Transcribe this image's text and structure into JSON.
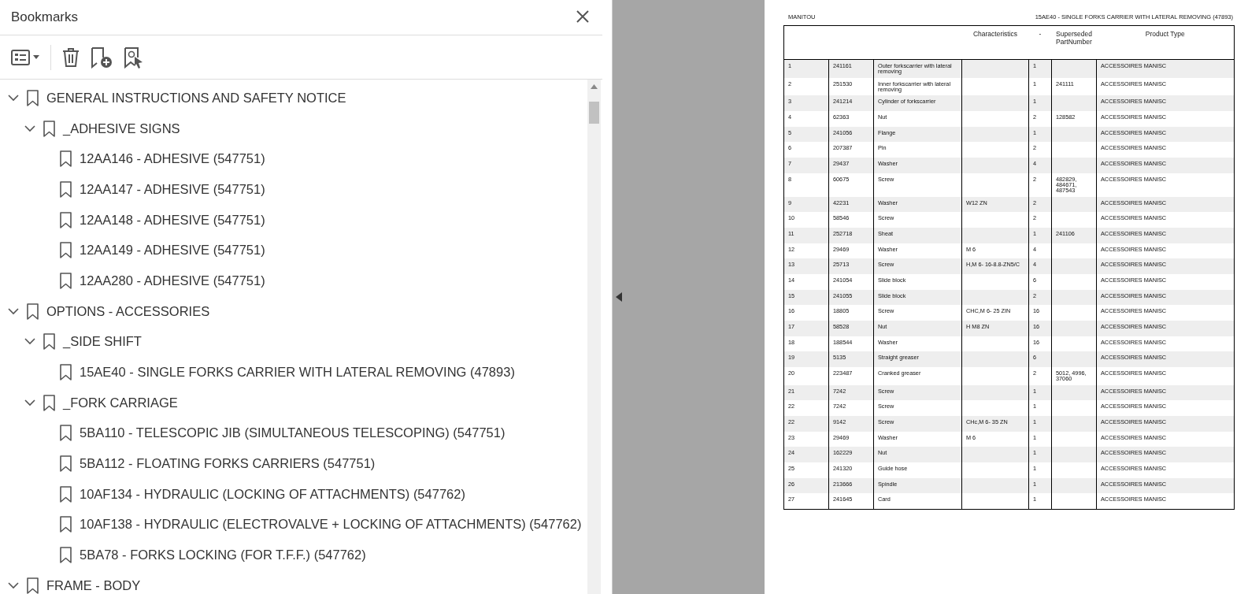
{
  "panel": {
    "title": "Bookmarks"
  },
  "bookmarks": [
    {
      "label": "GENERAL INSTRUCTIONS AND SAFETY NOTICE",
      "expanded": true,
      "children": [
        {
          "label": "_ADHESIVE SIGNS",
          "expanded": true,
          "children": [
            {
              "label": "12AA146 - ADHESIVE (547751)"
            },
            {
              "label": "12AA147 - ADHESIVE (547751)"
            },
            {
              "label": "12AA148 - ADHESIVE (547751)"
            },
            {
              "label": "12AA149 - ADHESIVE (547751)"
            },
            {
              "label": "12AA280 - ADHESIVE (547751)"
            }
          ]
        }
      ]
    },
    {
      "label": "OPTIONS - ACCESSORIES",
      "expanded": true,
      "children": [
        {
          "label": "_SIDE SHIFT",
          "expanded": true,
          "children": [
            {
              "label": "15AE40 - SINGLE FORKS CARRIER WITH LATERAL REMOVING (47893)"
            }
          ]
        },
        {
          "label": "_FORK CARRIAGE",
          "expanded": true,
          "children": [
            {
              "label": "5BA110 - TELESCOPIC JIB (SIMULTANEOUS TELESCOPING) (547751)"
            },
            {
              "label": "5BA112 - FLOATING FORKS CARRIERS (547751)"
            },
            {
              "label": "10AF134 - HYDRAULIC (LOCKING OF ATTACHMENTS) (547762)"
            },
            {
              "label": "10AF138 - HYDRAULIC (ELECTROVALVE + LOCKING OF ATTACHMENTS) (547762)"
            },
            {
              "label": "5BA78 - FORKS LOCKING (FOR T.F.F.) (547762)"
            }
          ]
        }
      ]
    },
    {
      "label": "FRAME - BODY",
      "expanded": true
    }
  ],
  "document": {
    "header_left": "MANITOU",
    "header_right": "15AE40 - SINGLE FORKS CARRIER WITH LATERAL REMOVING (47893)",
    "columns": [
      "",
      "",
      "",
      "Characteristics",
      "-",
      "SupersededPartNumber",
      "Product Type"
    ],
    "rows": [
      [
        "1",
        "241161",
        "Outer forkscarrier with lateral removing",
        "",
        "1",
        "",
        "ACCESSOIRES MANISC"
      ],
      [
        "2",
        "251530",
        "Inner forkscarrier with lateral removing",
        "",
        "1",
        "241111",
        "ACCESSOIRES MANISC"
      ],
      [
        "3",
        "241214",
        "Cylinder of forkscarrier",
        "",
        "1",
        "",
        "ACCESSOIRES MANISC"
      ],
      [
        "4",
        "62363",
        "Nut",
        "",
        "2",
        "128582",
        "ACCESSOIRES MANISC"
      ],
      [
        "5",
        "241056",
        "Flange",
        "",
        "1",
        "",
        "ACCESSOIRES MANISC"
      ],
      [
        "6",
        "207387",
        "Pin",
        "",
        "2",
        "",
        "ACCESSOIRES MANISC"
      ],
      [
        "7",
        "29437",
        "Washer",
        "",
        "4",
        "",
        "ACCESSOIRES MANISC"
      ],
      [
        "8",
        "60675",
        "Screw",
        "",
        "2",
        "482829, 484671, 487543",
        "ACCESSOIRES MANISC"
      ],
      [
        "9",
        "42231",
        "Washer",
        "W12 ZN",
        "2",
        "",
        "ACCESSOIRES MANISC"
      ],
      [
        "10",
        "58546",
        "Screw",
        "",
        "2",
        "",
        "ACCESSOIRES MANISC"
      ],
      [
        "11",
        "252718",
        "Sheat",
        "",
        "1",
        "241106",
        "ACCESSOIRES MANISC"
      ],
      [
        "12",
        "29469",
        "Washer",
        "M  6",
        "4",
        "",
        "ACCESSOIRES MANISC"
      ],
      [
        "13",
        "25713",
        "Screw",
        "H,M 6- 16-8.8-ZN5/C",
        "4",
        "",
        "ACCESSOIRES MANISC"
      ],
      [
        "14",
        "241054",
        "Slide block",
        "",
        "6",
        "",
        "ACCESSOIRES MANISC"
      ],
      [
        "15",
        "241055",
        "Slide block",
        "",
        "2",
        "",
        "ACCESSOIRES MANISC"
      ],
      [
        "16",
        "18805",
        "Screw",
        "CHC,M 6- 25 ZIN",
        "16",
        "",
        "ACCESSOIRES MANISC"
      ],
      [
        "17",
        "58528",
        "Nut",
        "H M8 ZN",
        "16",
        "",
        "ACCESSOIRES MANISC"
      ],
      [
        "18",
        "188544",
        "Washer",
        "",
        "16",
        "",
        "ACCESSOIRES MANISC"
      ],
      [
        "19",
        "5135",
        "Straight greaser",
        "",
        "6",
        "",
        "ACCESSOIRES MANISC"
      ],
      [
        "20",
        "223487",
        "Cranked greaser",
        "",
        "2",
        "5012, 4996, 37060",
        "ACCESSOIRES MANISC"
      ],
      [
        "21",
        "7242",
        "Screw",
        "",
        "1",
        "",
        "ACCESSOIRES MANISC"
      ],
      [
        "22",
        "7242",
        "Screw",
        "",
        "1",
        "",
        "ACCESSOIRES MANISC"
      ],
      [
        "22",
        "9142",
        "Screw",
        "CHc,M 6- 35 ZN",
        "1",
        "",
        "ACCESSOIRES MANISC"
      ],
      [
        "23",
        "29469",
        "Washer",
        "M  6",
        "1",
        "",
        "ACCESSOIRES MANISC"
      ],
      [
        "24",
        "162229",
        "Nut",
        "",
        "1",
        "",
        "ACCESSOIRES MANISC"
      ],
      [
        "25",
        "241320",
        "Guide hose",
        "",
        "1",
        "",
        "ACCESSOIRES MANISC"
      ],
      [
        "26",
        "213666",
        "Spindle",
        "",
        "1",
        "",
        "ACCESSOIRES MANISC"
      ],
      [
        "27",
        "241645",
        "Card",
        "",
        "1",
        "",
        "ACCESSOIRES MANISC"
      ]
    ]
  }
}
